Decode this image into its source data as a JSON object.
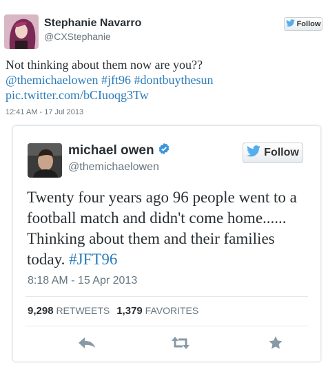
{
  "tweet": {
    "author_name": "Stephanie Navarro",
    "author_handle": "@CXStephanie",
    "follow_label": "Follow",
    "text_plain": "Not thinking about them now are you??",
    "link_mention": "@themichaelowen",
    "link_hashtag1": "#jft96",
    "link_hashtag2": "#dontbuythesun",
    "link_pic": "pic.twitter.com/bCIuoqg3Tw",
    "timestamp": "12:41 AM - 17 Jul 2013"
  },
  "embedded": {
    "author_name": "michael owen",
    "author_handle": "@themichaelowen",
    "follow_label": "Follow",
    "text_plain": "Twenty four years ago 96 people went to a football match and didn't come home...... Thinking about them and their families today.",
    "hashtag": "#JFT96",
    "timestamp": "8:18 AM - 15 Apr 2013",
    "retweets_count": "9,298",
    "retweets_label": "RETWEETS",
    "favorites_count": "1,379",
    "favorites_label": "FAVORITES"
  },
  "colors": {
    "link": "#2b7bb9",
    "verified": "#3b94d9",
    "twitter_bird": "#55acee",
    "muted": "#66757f",
    "action_icon": "#8899a6"
  },
  "icons": [
    "twitter-bird-icon",
    "verified-badge-icon",
    "reply-icon",
    "retweet-icon",
    "favorite-icon"
  ]
}
